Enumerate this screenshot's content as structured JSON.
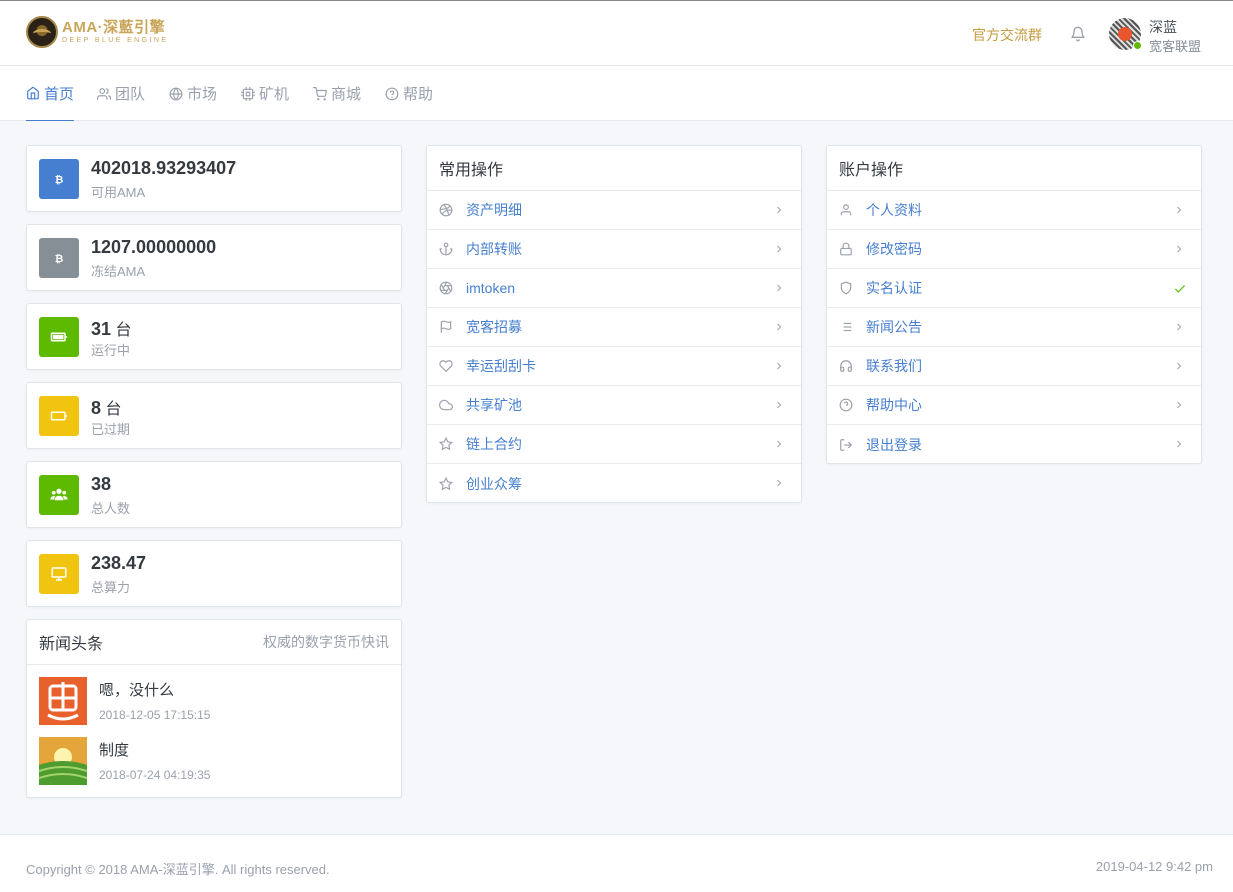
{
  "header": {
    "logo_title": "AMA·深藍引擎",
    "logo_sub": "DEEP BLUE ENGINE",
    "group_link": "官方交流群",
    "user_name": "深蓝",
    "user_org": "宽客联盟"
  },
  "nav": {
    "home": "首页",
    "team": "团队",
    "market": "市场",
    "miner": "矿机",
    "mall": "商城",
    "help": "帮助"
  },
  "stats": [
    {
      "value": "402018.93293407",
      "unit": "",
      "label": "可用AMA",
      "color": "#467fcf",
      "icon": "bitcoin-icon"
    },
    {
      "value": "1207.00000000",
      "unit": "",
      "label": "冻结AMA",
      "color": "#868e96",
      "icon": "bitcoin-icon"
    },
    {
      "value": "31",
      "unit": " 台",
      "label": "运行中",
      "color": "#5eba00",
      "icon": "battery-full-icon"
    },
    {
      "value": "8",
      "unit": " 台",
      "label": "已过期",
      "color": "#f1c40f",
      "icon": "battery-empty-icon"
    },
    {
      "value": "38",
      "unit": "",
      "label": "总人数",
      "color": "#5eba00",
      "icon": "users-icon"
    },
    {
      "value": "238.47",
      "unit": "",
      "label": "总算力",
      "color": "#f1c40f",
      "icon": "desktop-icon"
    }
  ],
  "news": {
    "title": "新闻头条",
    "subtitle": "权威的数字货币快讯",
    "items": [
      {
        "title": "嗯，没什么",
        "date": "2018-12-05 17:15:15"
      },
      {
        "title": "制度",
        "date": "2018-07-24 04:19:35"
      }
    ]
  },
  "common_ops": {
    "title": "常用操作",
    "items": [
      "资产明细",
      "内部转账",
      "imtoken",
      "宽客招募",
      "幸运刮刮卡",
      "共享矿池",
      "链上合约",
      "创业众筹"
    ]
  },
  "account_ops": {
    "title": "账户操作",
    "items": [
      "个人资料",
      "修改密码",
      "实名认证",
      "新闻公告",
      "联系我们",
      "帮助中心",
      "退出登录"
    ]
  },
  "footer": {
    "copyright": "Copyright © 2018 AMA-深蓝引擎. All rights reserved.",
    "clock": "2019-04-12 9:42 pm"
  },
  "colors": {
    "accent": "#467fcf",
    "gold": "#c79b3f",
    "success": "#5eba00",
    "warning": "#f1c40f"
  }
}
